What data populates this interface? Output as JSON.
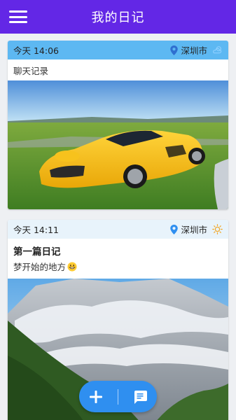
{
  "appbar": {
    "title": "我的日记",
    "menu_icon": "menu-icon"
  },
  "entries": [
    {
      "date": "今天 14:06",
      "location": "深圳市",
      "weather_icon": "partly-cloudy-icon",
      "title": "",
      "body": "聊天记录",
      "image": "yellow-sports-car-photo",
      "header_color": "#5db8f2"
    },
    {
      "date": "今天 14:11",
      "location": "深圳市",
      "weather_icon": "sun-icon",
      "title": "第一篇日记",
      "body": "梦开始的地方",
      "body_emoji": "grinning-face-icon",
      "image": "snowy-mountain-photo",
      "header_color": "#e8f3fb"
    }
  ],
  "fab": {
    "add_icon": "plus-icon",
    "chat_icon": "message-icon",
    "color": "#2f8ff0"
  },
  "colors": {
    "appbar": "#6327e6",
    "pin": "#2f8ff0"
  }
}
